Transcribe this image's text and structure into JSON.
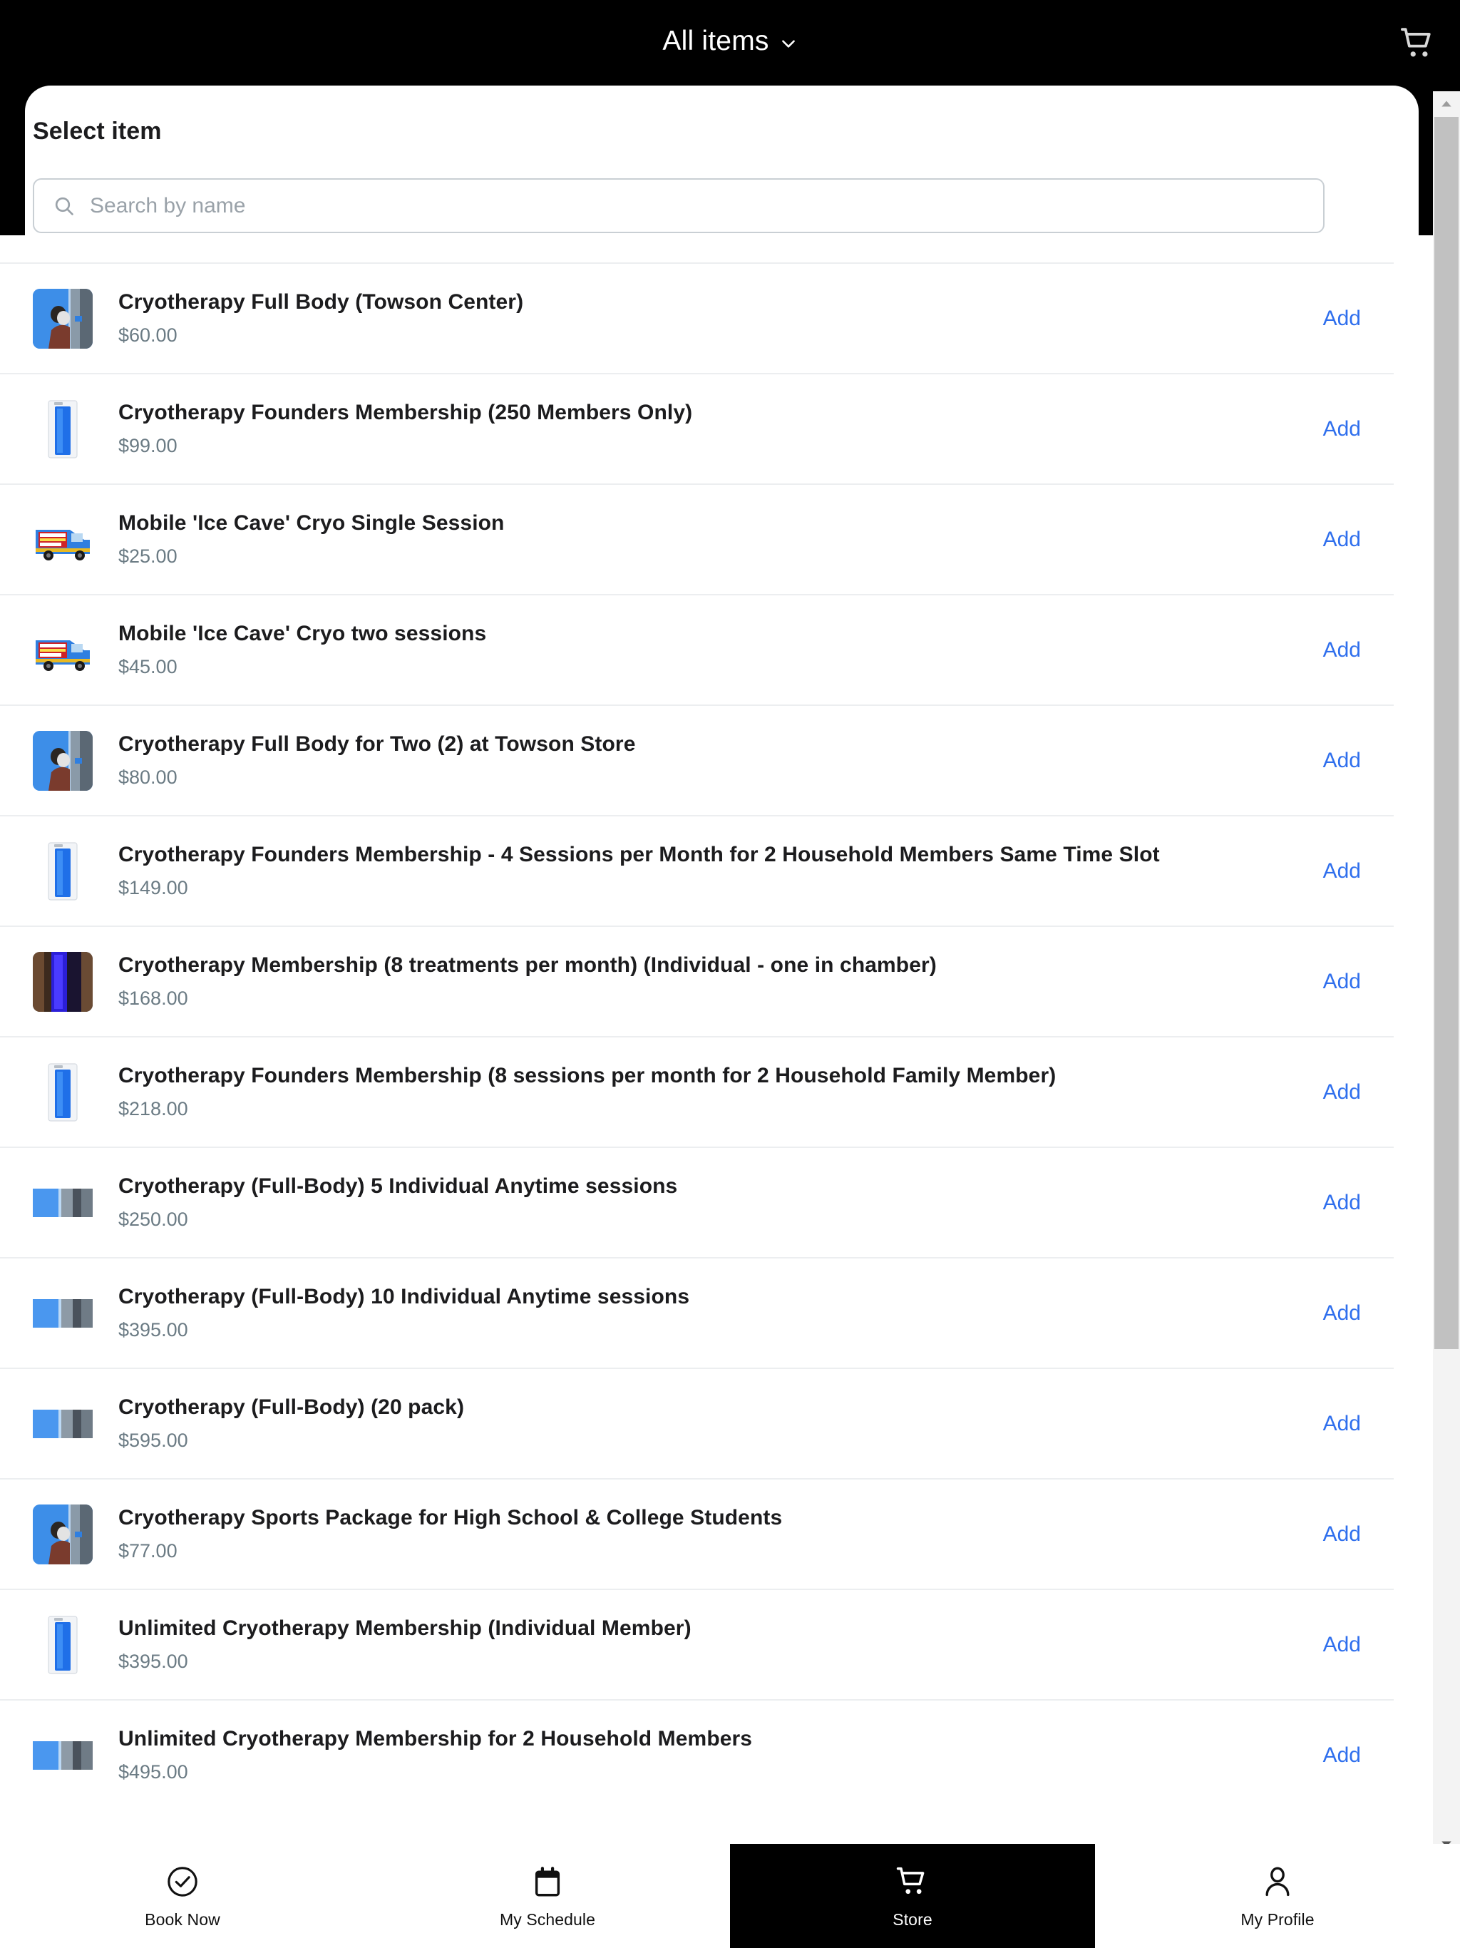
{
  "header": {
    "title": "All items",
    "chevron_icon": "chevron-down-icon",
    "cart_icon": "shopping-cart-icon"
  },
  "sheet": {
    "title": "Select item",
    "search": {
      "placeholder": "Search by name",
      "value": "",
      "icon": "search-icon"
    },
    "add_label": "Add"
  },
  "colors": {
    "accent_blue": "#2f6fed",
    "header_black": "#000000",
    "text_primary": "#1c1c1e",
    "text_secondary": "#6b7b84",
    "divider": "#eceef0",
    "placeholder": "#9aa2a9"
  },
  "items": [
    {
      "name": "Cryotherapy Full Body (Towson Center)",
      "price": "$60.00",
      "thumb": "cryo-chamber-person-blue",
      "add_label": "Add"
    },
    {
      "name": "Cryotherapy Founders Membership (250 Members Only)",
      "price": "$99.00",
      "thumb": "cryo-chamber-white-tall",
      "add_label": "Add"
    },
    {
      "name": "Mobile 'Ice Cave' Cryo Single Session",
      "price": "$25.00",
      "thumb": "ice-cave-van",
      "add_label": "Add"
    },
    {
      "name": "Mobile 'Ice Cave' Cryo two sessions",
      "price": "$45.00",
      "thumb": "ice-cave-van",
      "add_label": "Add"
    },
    {
      "name": "Cryotherapy Full Body for Two (2) at Towson Store",
      "price": "$80.00",
      "thumb": "cryo-chamber-person-blue",
      "add_label": "Add"
    },
    {
      "name": "Cryotherapy Founders Membership - 4 Sessions per Month for 2 Household Members Same Time Slot",
      "price": "$149.00",
      "thumb": "cryo-chamber-white-tall",
      "add_label": "Add"
    },
    {
      "name": "Cryotherapy Membership (8 treatments per month) (Individual - one in chamber)",
      "price": "$168.00",
      "thumb": "cryo-chamber-dark-purple",
      "add_label": "Add"
    },
    {
      "name": "Cryotherapy Founders Membership (8 sessions per month for 2 Household Family Member)",
      "price": "$218.00",
      "thumb": "cryo-chamber-white-tall",
      "add_label": "Add"
    },
    {
      "name": "Cryotherapy (Full-Body) 5 Individual Anytime sessions",
      "price": "$250.00",
      "thumb": "cryo-chamber-wide-blue",
      "add_label": "Add"
    },
    {
      "name": "Cryotherapy (Full-Body) 10 Individual Anytime sessions",
      "price": "$395.00",
      "thumb": "cryo-chamber-wide-blue",
      "add_label": "Add"
    },
    {
      "name": "Cryotherapy (Full-Body) (20 pack)",
      "price": "$595.00",
      "thumb": "cryo-chamber-wide-blue",
      "add_label": "Add"
    },
    {
      "name": "Cryotherapy Sports Package for High School & College Students",
      "price": "$77.00",
      "thumb": "cryo-chamber-person-blue",
      "add_label": "Add"
    },
    {
      "name": "Unlimited Cryotherapy Membership (Individual Member)",
      "price": "$395.00",
      "thumb": "cryo-chamber-white-tall",
      "add_label": "Add"
    },
    {
      "name": "Unlimited Cryotherapy Membership for 2 Household Members",
      "price": "$495.00",
      "thumb": "cryo-chamber-wide-blue",
      "add_label": "Add"
    }
  ],
  "bottom_nav": [
    {
      "label": "Book Now",
      "icon": "check-circle-icon",
      "active": false
    },
    {
      "label": "My Schedule",
      "icon": "calendar-icon",
      "active": false
    },
    {
      "label": "Store",
      "icon": "shopping-cart-icon",
      "active": true
    },
    {
      "label": "My Profile",
      "icon": "user-icon",
      "active": false
    }
  ],
  "scrollbar": {
    "up_arrow_icon": "triangle-up-icon",
    "down_arrow_icon": "triangle-down-icon"
  }
}
